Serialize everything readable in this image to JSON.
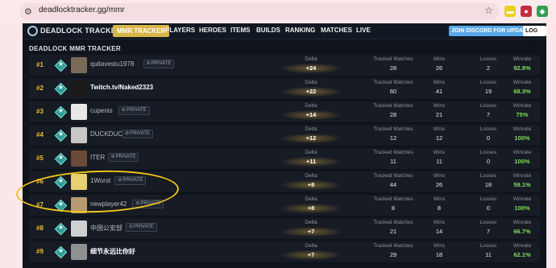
{
  "browser": {
    "url": "deadlocktracker.gg/mmr"
  },
  "nav": {
    "logo": "DEADLOCK TRACKER",
    "items": [
      "MMR TRACKER",
      "PLAYERS",
      "HEROES",
      "ITEMS",
      "BUILDS",
      "RANKING",
      "MATCHES",
      "LIVE"
    ],
    "discord": "JOIN DISCORD FOR UPDATES",
    "login": "LOG IN"
  },
  "page": {
    "title": "DEADLOCK MMR TRACKER",
    "private_label": "PRIVATE",
    "columns": {
      "delta": "Delta",
      "tracked": "Tracked Matches",
      "wins": "Wins",
      "losses": "Losses",
      "winrate": "Winrate"
    }
  },
  "rows": [
    {
      "rank": "#1",
      "name": "quitavestu1978",
      "private": true,
      "delta": "+24",
      "tracked": "28",
      "wins": "26",
      "losses": "2",
      "winrate": "92.9%",
      "avatar_color": "#7a6a58"
    },
    {
      "rank": "#2",
      "name": "Twitch.tv/Naked2323",
      "private": false,
      "delta": "+22",
      "tracked": "60",
      "wins": "41",
      "losses": "19",
      "winrate": "68.3%",
      "avatar_color": "#1a1a1a"
    },
    {
      "rank": "#3",
      "name": "cupenis",
      "private": true,
      "delta": "+14",
      "tracked": "28",
      "wins": "21",
      "losses": "7",
      "winrate": "75%",
      "avatar_color": "#e8e8e8"
    },
    {
      "rank": "#4",
      "name": "DUCKDUCK",
      "private": true,
      "delta": "+12",
      "tracked": "12",
      "wins": "12",
      "losses": "0",
      "winrate": "100%",
      "avatar_color": "#c8c8c8"
    },
    {
      "rank": "#5",
      "name": "ITER",
      "private": true,
      "delta": "+11",
      "tracked": "11",
      "wins": "11",
      "losses": "0",
      "winrate": "100%",
      "avatar_color": "#6a4a38"
    },
    {
      "rank": "#6",
      "name": "1Worst",
      "private": true,
      "delta": "+8",
      "tracked": "44",
      "wins": "26",
      "losses": "18",
      "winrate": "59.1%",
      "avatar_color": "#e8d070"
    },
    {
      "rank": "#7",
      "name": "newplayer42",
      "private": true,
      "delta": "+8",
      "tracked": "8",
      "wins": "8",
      "losses": "0",
      "winrate": "100%",
      "avatar_color": "#b89a70"
    },
    {
      "rank": "#8",
      "name": "中国公安部",
      "private": true,
      "delta": "+7",
      "tracked": "21",
      "wins": "14",
      "losses": "7",
      "winrate": "66.7%",
      "avatar_color": "#d0d0d0"
    },
    {
      "rank": "#9",
      "name": "细节永远比你好",
      "private": false,
      "delta": "+7",
      "tracked": "29",
      "wins": "18",
      "losses": "11",
      "winrate": "62.1%",
      "avatar_color": "#909090"
    }
  ]
}
